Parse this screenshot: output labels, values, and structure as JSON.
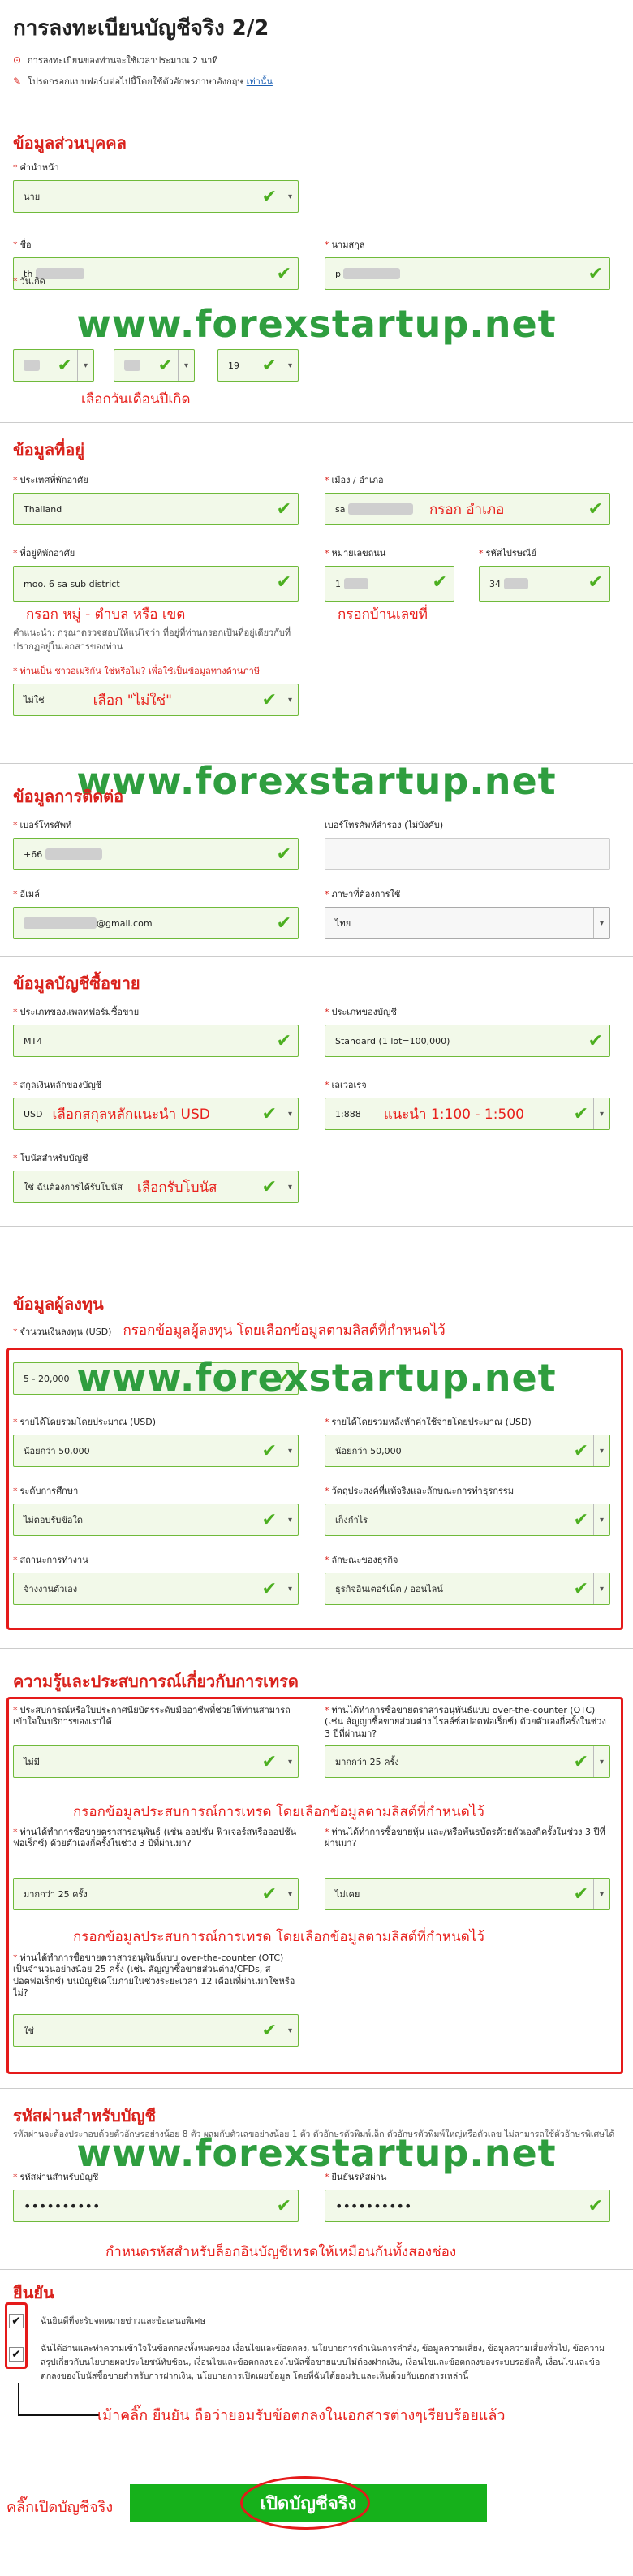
{
  "page": {
    "title": "การลงทะเบียนบัญชีจริง 2/2",
    "note_time": "การลงทะเบียนของท่านจะใช้เวลาประมาณ 2 นาที",
    "note_lang": "โปรดกรอกแบบฟอร์มต่อไปนี้โดยใช้ตัวอักษรภาษาอังกฤษ",
    "note_lang_link": "เท่านั้น"
  },
  "watermark": "www.forexstartup.net",
  "personal": {
    "title": "ข้อมูลส่วนบุคคล",
    "prefix_label": "คำนำหน้า",
    "prefix_value": "นาย",
    "firstname_label": "ชื่อ",
    "firstname_value": "th",
    "lastname_label": "นามสกุล",
    "lastname_value": "p",
    "dob_label": "วันเกิด",
    "dob_year": "19",
    "dob_note": "เลือกวันเดือนปีเกิด"
  },
  "address": {
    "title": "ข้อมูลที่อยู่",
    "country_label": "ประเทศที่พักอาศัย",
    "country_value": "Thailand",
    "city_label": "เมือง / อำเภอ",
    "city_value": "sa",
    "city_note": "กรอก อำเภอ",
    "addr_label": "ที่อยู่ที่พักอาศัย",
    "addr_value": "moo. 6  sa       sub district",
    "addr_note": "กรอก หมู่ - ตำบล หรือ เขต",
    "addr_hint": "คำแนะนำ: กรุณาตรวจสอบให้แน่ใจว่า ที่อยู่ที่ท่านกรอกเป็นที่อยู่เดียวกับที่ปรากฏอยู่ในเอกสารของท่าน",
    "house_label": "หมายเลขถนน",
    "house_value": "1",
    "house_note": "กรอกบ้านเลขที่",
    "zip_label": "รหัสไปรษณีย์",
    "zip_value": "34",
    "us_label": "ท่านเป็น ชาวอเมริกัน ใช่หรือไม่? เพื่อใช้เป็นข้อมูลทางด้านภาษี",
    "us_value": "ไม่ใช่",
    "us_note": "เลือก \"ไม่ใช่\""
  },
  "contact": {
    "title": "ข้อมูลการติดต่อ",
    "phone_label": "เบอร์โทรศัพท์",
    "phone_value": "+66",
    "phone2_label": "เบอร์โทรศัพท์สำรอง (ไม่บังคับ)",
    "email_label": "อีเมล์",
    "email_value": "@gmail.com",
    "lang_label": "ภาษาที่ต้องการใช้",
    "lang_value": "ไทย"
  },
  "trading": {
    "title": "ข้อมูลบัญชีซื้อขาย",
    "platform_label": "ประเภทของแพลทฟอร์มซื้อขาย",
    "platform_value": "MT4",
    "acctype_label": "ประเภทของบัญชี",
    "acctype_value": "Standard (1 lot=100,000)",
    "currency_label": "สกุลเงินหลักของบัญชี",
    "currency_value": "USD",
    "currency_note": "เลือกสกุลหลักแนะนำ USD",
    "leverage_label": "เลเวอเรจ",
    "leverage_value": "1:888",
    "leverage_note": "แนะนำ 1:100 - 1:500",
    "bonus_label": "โบนัสสำหรับบัญชี",
    "bonus_value": "ใช่ ฉันต้องการได้รับโบนัส",
    "bonus_note": "เลือกรับโบนัส"
  },
  "investor": {
    "title": "ข้อมูลผู้ลงทุน",
    "note": "กรอกข้อมูลผู้ลงทุน โดยเลือกข้อมูลตามลิสต์ที่กำหนดไว้",
    "capital_label": "จำนวนเงินลงทุน (USD)",
    "capital_value": "5 - 20,000",
    "income_label": "รายได้โดยรวมโดยประมาณ (USD)",
    "income_value": "น้อยกว่า 50,000",
    "net_label": "รายได้โดยรวมหลังหักค่าใช้จ่ายโดยประมาณ (USD)",
    "net_value": "น้อยกว่า 50,000",
    "edu_label": "ระดับการศึกษา",
    "edu_value": "ไม่ตอบรับข้อใด",
    "purpose_label": "วัตถุประสงค์ที่แท้จริงและลักษณะการทำธุรกรรม",
    "purpose_value": "เก็งกำไร",
    "employ_label": "สถานะการทำงาน",
    "employ_value": "จ้างงานตัวเอง",
    "biz_label": "ลักษณะของธุรกิจ",
    "biz_value": "ธุรกิจอินเตอร์เน็ต / ออนไลน์"
  },
  "experience": {
    "title": "ความรู้และประสบการณ์เกี่ยวกับการเทรด",
    "q1_label": "ประสบการณ์หรือใบประกาศนียบัตรระดับมืออาชีพที่ช่วยให้ท่านสามารถเข้าใจในบริการของเราได้",
    "q1_value": "ไม่มี",
    "q2_label": "ท่านได้ทำการซื้อขายตราสารอนุพันธ์แบบ over-the-counter (OTC) (เช่น สัญญาซื้อขายส่วนต่าง ไรลล์ซ์สปอตฟอเร็กซ์) ด้วยตัวเองกี่ครั้งในช่วง 3 ปีที่ผ่านมา?",
    "q2_value": "มากกว่า 25 ครั้ง",
    "q3_label": "ท่านได้ทำการซื้อขายตราสารอนุพันธ์ (เช่น ออปชั่น ฟิวเจอร์สหรือออปชั่น ฟอเร็กซ์) ด้วยตัวเองกี่ครั้งในช่วง 3 ปีที่ผ่านมา?",
    "q3_value": "มากกว่า 25 ครั้ง",
    "q4_label": "ท่านได้ทำการซื้อขายหุ้น และ/หรือพันธบัตรด้วยตัวเองกี่ครั้งในช่วง 3 ปีที่ผ่านมา?",
    "q4_value": "ไม่เคย",
    "q5_label": "ท่านได้ทำการซื้อขายตราสารอนุพันธ์แบบ over-the-counter (OTC) เป็นจำนวนอย่างน้อย 25 ครั้ง (เช่น สัญญาซื้อขายส่วนต่าง/CFDs, สปอตฟอเร็กซ์) บนบัญชีเดโมภายในช่วงระยะเวลา 12 เดือนที่ผ่านมาใช่หรือไม่?",
    "q5_value": "ใช่",
    "note1": "กรอกข้อมูลประสบการณ์การเทรด โดยเลือกข้อมูลตามลิสต์ที่กำหนดไว้",
    "note2": "กรอกข้อมูลประสบการณ์การเทรด โดยเลือกข้อมูลตามลิสต์ที่กำหนดไว้"
  },
  "password": {
    "title": "รหัสผ่านสำหรับบัญชี",
    "hint": "รหัสผ่านจะต้องประกอบด้วยตัวอักษรอย่างน้อย 8 ตัว ผสมกับตัวเลขอย่างน้อย 1 ตัว ตัวอักษรตัวพิมพ์เล็ก ตัวอักษรตัวพิมพ์ใหญ่หรือตัวเลข ไม่สามารถใช้ตัวอักษรพิเศษได้",
    "pw_label": "รหัสผ่านสำหรับบัญชี",
    "pw_value": "••••••••••",
    "pw2_label": "ยืนยันรหัสผ่าน",
    "pw2_value": "••••••••••",
    "note": "กำหนดรหัสสำหรับล็อกอินบัญชีเทรดให้เหมือนกันทั้งสองช่อง"
  },
  "confirm": {
    "title": "ยืนยัน",
    "check1": "ฉันยินดีที่จะรับจดหมายข่าวและข้อเสนอพิเศษ",
    "check2": "ฉันได้อ่านและทำความเข้าใจในข้อตกลงทั้งหมดของ เงื่อนไขและข้อตกลง, นโยบายการดำเนินการคำสั่ง, ข้อมูลความเสี่ยง, ข้อมูลความเสี่ยงทั่วไป, ข้อความสรุปเกี่ยวกับนโยบายผลประโยชน์ทับซ้อน, เงื่อนไขและข้อตกลงของโบนัสซื้อขายแบบไม่ต้องฝากเงิน, เงื่อนไขและข้อตกลงของระบบรอยัลตี้, เงื่อนไขและข้อตกลงของโบนัสซื้อขายสำหรับการฝากเงิน, นโยบายการเปิดเผยข้อมูล โดยที่ฉันได้ยอมรับและเห็นด้วยกับเอกสารเหล่านี้",
    "check_value": "✔",
    "note": "เม้าคลิ๊ก ยืนยัน ถือว่ายอมรับข้อตกลงในเอกสารต่างๆเรียบร้อยแล้ว",
    "submit_note": "คลิ๊กเปิดบัญชีจริง",
    "submit_label": "เปิดบัญชีจริง"
  },
  "glyphs": {
    "check": "✔",
    "arrow": "▾",
    "alert": "⊙",
    "pencil": "✎"
  }
}
